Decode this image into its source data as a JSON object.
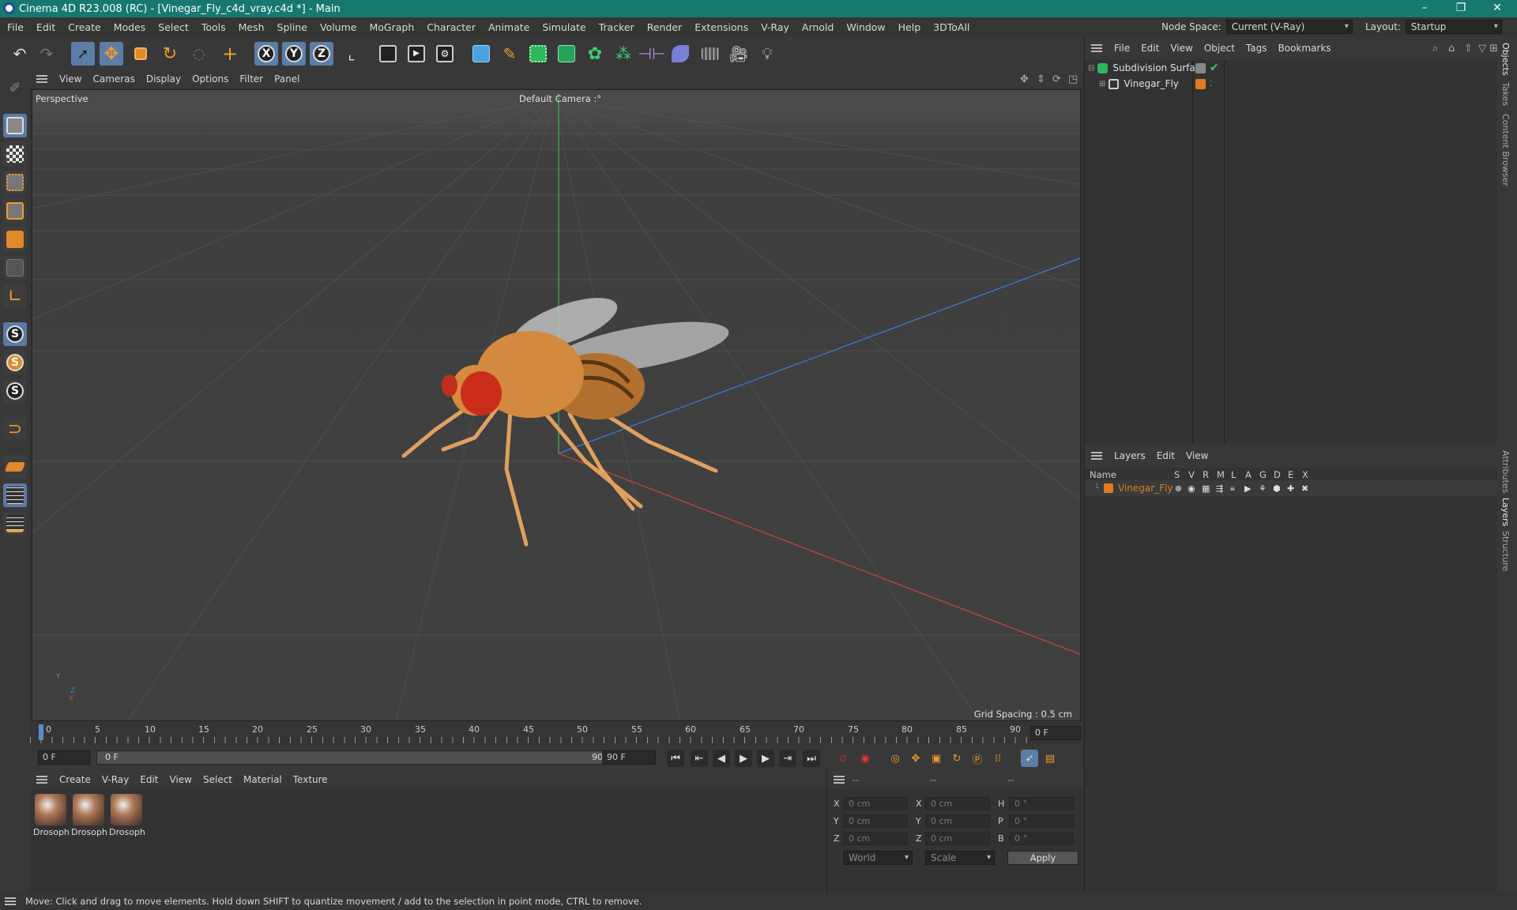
{
  "window": {
    "title": "Cinema 4D R23.008 (RC) - [Vinegar_Fly_c4d_vray.c4d *] - Main",
    "minimize": "–",
    "restore": "❐",
    "close": "✕"
  },
  "menubar": {
    "items": [
      "File",
      "Edit",
      "Create",
      "Modes",
      "Select",
      "Tools",
      "Mesh",
      "Spline",
      "Volume",
      "MoGraph",
      "Character",
      "Animate",
      "Simulate",
      "Tracker",
      "Render",
      "Extensions",
      "V-Ray",
      "Arnold",
      "Window",
      "Help",
      "3DToAll"
    ],
    "node_space_label": "Node Space:",
    "node_space_value": "Current (V-Ray)",
    "layout_label": "Layout:",
    "layout_value": "Startup"
  },
  "toolbar": {
    "axis_labels": [
      "X",
      "Y",
      "Z"
    ],
    "icons": [
      "undo-icon",
      "redo-icon",
      "select-icon",
      "move-icon",
      "scale-icon",
      "rotate-icon",
      "live-select-icon",
      "add-icon",
      "x-axis-icon",
      "y-axis-icon",
      "z-axis-icon",
      "coord-system-icon",
      "render-region-icon",
      "render-view-icon",
      "render-settings-icon",
      "cube-icon",
      "pen-icon",
      "subdivision-icon",
      "extrude-icon",
      "cloner-icon",
      "mograph-icon",
      "symmetry-icon",
      "deformer-icon",
      "floor-icon",
      "camera-icon",
      "light-icon"
    ]
  },
  "left_tools": {
    "s_labels": [
      "S",
      "S",
      "S"
    ]
  },
  "viewport": {
    "menu": [
      "View",
      "Cameras",
      "Display",
      "Options",
      "Filter",
      "Panel"
    ],
    "label": "Perspective",
    "camera": "Default Camera :°",
    "grid_spacing": "Grid Spacing : 0.5 cm",
    "axis_y": "Y",
    "axis_z": "Z",
    "axis_x": "X"
  },
  "timeline": {
    "ticks": [
      "0",
      "5",
      "10",
      "15",
      "20",
      "25",
      "30",
      "35",
      "40",
      "45",
      "50",
      "55",
      "60",
      "65",
      "70",
      "75",
      "80",
      "85",
      "90"
    ],
    "current_frame": "0 F"
  },
  "transport": {
    "start": "0 F",
    "range_start": "0 F",
    "range_end": "90 F",
    "end": "90 F"
  },
  "materials": {
    "menu": [
      "Create",
      "V-Ray",
      "Edit",
      "View",
      "Select",
      "Material",
      "Texture"
    ],
    "items": [
      "Drosoph",
      "Drosoph",
      "Drosoph"
    ]
  },
  "coords": {
    "header": [
      "--",
      "--",
      "--"
    ],
    "rows": [
      {
        "a": "X",
        "av": "0 cm",
        "b": "X",
        "bv": "0 cm",
        "c": "H",
        "cv": "0 °"
      },
      {
        "a": "Y",
        "av": "0 cm",
        "b": "Y",
        "bv": "0 cm",
        "c": "P",
        "cv": "0 °"
      },
      {
        "a": "Z",
        "av": "0 cm",
        "b": "Z",
        "bv": "0 cm",
        "c": "B",
        "cv": "0 °"
      }
    ],
    "space": "World",
    "mode": "Scale",
    "apply": "Apply"
  },
  "objects": {
    "menu": [
      "File",
      "Edit",
      "View",
      "Object",
      "Tags",
      "Bookmarks"
    ],
    "items": [
      {
        "name": "Subdivision Surface"
      },
      {
        "name": "Vinegar_Fly"
      }
    ]
  },
  "layers": {
    "menu": [
      "Layers",
      "Edit",
      "View"
    ],
    "name_header": "Name",
    "col_headers": [
      "S",
      "V",
      "R",
      "M",
      "L",
      "A",
      "G",
      "D",
      "E",
      "X"
    ],
    "items": [
      {
        "name": "Vinegar_Fly"
      }
    ]
  },
  "side_tabs": [
    "Objects",
    "Takes",
    "Content Browser",
    "Attributes",
    "Layers",
    "Structure"
  ],
  "status": "Move: Click and drag to move elements. Hold down SHIFT to quantize movement / add to the selection in point mode, CTRL to remove.",
  "colors": {
    "accent": "#15796f",
    "orange": "#e07b22",
    "selection": "#5b7ea8"
  }
}
